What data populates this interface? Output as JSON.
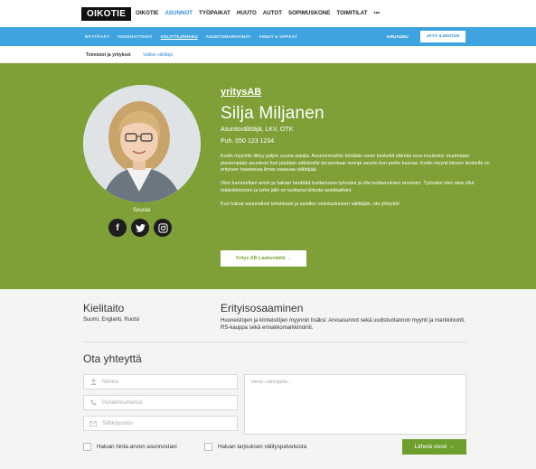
{
  "topnav": {
    "logo": "OIKOTIE",
    "items": [
      "OIKOTIE",
      "ASUNNOT",
      "TYÖPAIKAT",
      "HUUTO",
      "AUTOT",
      "SOPIMUSKONE",
      "TOIMITILAT",
      "•••"
    ],
    "active_index": 1
  },
  "subnav": {
    "items": [
      "MYYTÄVÄT",
      "VUOKRATTAVAT",
      "VÄLITTÄJÄHAKU",
      "ASUNTOMARKKINAT",
      "VINKIT & OPPAAT"
    ],
    "active_index": 2,
    "login": "KIRJAUDU",
    "post_ad": "JÄTÄ ILMOITUS"
  },
  "breadcrumb": {
    "item1": "Toimistot ja yritykset",
    "item2": "Valitse välittäjä"
  },
  "agent": {
    "company": "yritysAB",
    "name": "Silja Miljanen",
    "title": "Asuntovälittäjä, LKV, OTK",
    "phone": "Puh. 050 123 1234",
    "bio": [
      "Kodin myyntiin liittyy paljon suuria asioita. Asunnonvaihto tehdään usein keskellä elämän isoa muutosta: muutetaan pienempään asuntoon kun jäädään eläkkeelle tai tarvitaan isompi asunto kun perhe kasvaa. Kodin myynti kiireen keskellä on erityisen haastavaa ilman osaavaa välittäjää.",
      "Olen luonteeltani avoin ja haluan herättää luottamusta työssäni ja olla luottamuksen arvoinen. Työssäni olen aina ollut määrätietoinen ja työni jälki on tuottanut kiitosta asiakkailtani.",
      "Kun haluat asunnollesi tehokkaan ja asiallen omistautuneen välittäjän, ota yhteyttä!"
    ],
    "cta": "Yritys AB Laaksolahti →",
    "follow_label": "Seuraa",
    "social": [
      "facebook-icon",
      "twitter-icon",
      "instagram-icon"
    ]
  },
  "languages": {
    "heading": "Kielitaito",
    "value": "Suomi, Englanti, Ruotsi"
  },
  "specialties": {
    "heading": "Erityisosaaminen",
    "value": "Huoneistojen ja kiinteistöjen myynnin lisäksi: Arvoasunnot sekä uudistuotannon myynti ja markkinointi, RS-kauppa sekä ennakkomarkkinointi."
  },
  "contact": {
    "heading": "Ota yhteyttä",
    "name_placeholder": "Nimesi",
    "phone_placeholder": "Puhelinnumerosi",
    "email_placeholder": "Sähköpostisi",
    "message_placeholder": "Viesti välittäjälle...",
    "checkbox1": "Haluan hinta-arvion asunnostani",
    "checkbox2": "Haluan tarjouksen välityspalveluista",
    "send": "Lähetä viesti  →"
  },
  "colors": {
    "brand_blue": "#3ea3de",
    "hero_green": "#7ea037",
    "button_green": "#6d9f2d"
  }
}
